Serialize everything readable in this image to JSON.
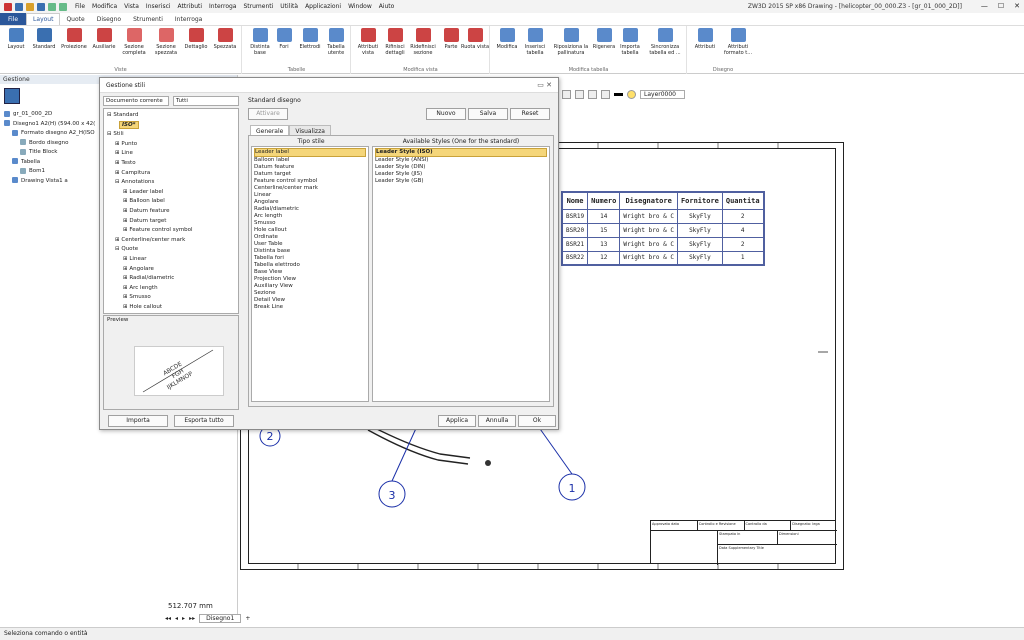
{
  "quick_menu": [
    "File",
    "Modifica",
    "Vista",
    "Inserisci",
    "Attributi",
    "Interroga",
    "Strumenti",
    "Utilità",
    "Applicazioni",
    "Window",
    "Aiuto"
  ],
  "window_title": "ZW3D 2015 SP x86    Drawing - [helicopter_00_000.Z3 - [gr_01_000_2D]]",
  "ribbon_tabs": [
    "File",
    "Layout",
    "Quote",
    "Disegno",
    "Strumenti",
    "Interroga"
  ],
  "active_tab": "Layout",
  "ribbon": {
    "viste": {
      "label": "Viste",
      "buttons": [
        "Layout",
        "Standard",
        "Proiezione",
        "Ausiliarie",
        "Sezione completa",
        "Sezione spezzata",
        "Dettaglio",
        "Spezzata"
      ]
    },
    "tabelle": {
      "label": "Tabelle",
      "buttons": [
        "Distinta base",
        "Fori",
        "Elettrodi",
        "Tabella utente"
      ]
    },
    "modifica_vista": {
      "label": "Modifica vista",
      "buttons": [
        "Attributi vista",
        "Rifinisci dettagli",
        "Ridefinisci sezione",
        "Parte",
        "Ruota vista"
      ]
    },
    "modifica_tabella": {
      "label": "Modifica tabella",
      "buttons": [
        "Modifica",
        "Inserisci tabella",
        "Riposiziona la pallinatura",
        "Rigenera",
        "Importa tabella",
        "Sincronizza tabella ed ..."
      ]
    },
    "disegno": {
      "label": "Disegno",
      "buttons": [
        "Attributi",
        "Attributi formato t..."
      ]
    }
  },
  "left_panel": {
    "title": "Gestione",
    "tree": [
      "gr_01_000_2D",
      "Disegno1 A2(H) (594.00 x 42(",
      "Formato disegno A2_H(ISO",
      "Bordo disegno",
      "Title Block",
      "Tabella",
      "Bom1",
      "Drawing Vista1 a"
    ]
  },
  "layer": "Layer0000",
  "bom": {
    "headers": [
      "Nome",
      "Numero",
      "Disegnatore",
      "Fornitore",
      "Quantita"
    ],
    "rows": [
      [
        "BSR19",
        "14",
        "Wright bro & C",
        "SkyFly",
        "2"
      ],
      [
        "BSR20",
        "15",
        "Wright bro & C",
        "SkyFly",
        "4"
      ],
      [
        "BSR21",
        "13",
        "Wright bro & C",
        "SkyFly",
        "2"
      ],
      [
        "BSR22",
        "12",
        "Wright bro & C",
        "SkyFly",
        "1"
      ]
    ]
  },
  "balloons": [
    "1",
    "2",
    "3"
  ],
  "title_block": {
    "cells": [
      "Approvato data",
      "Controllo e Revisione",
      "Controllo da",
      "Disegnato: lega",
      "Stampato in",
      "Dimensioni",
      "Data Supplementary Title"
    ]
  },
  "coords": "512.707 mm",
  "sheet_tab": "Disegno1",
  "status": "Seleziona comando o entità",
  "dialog": {
    "title": "Gestione stili",
    "scope": "Documento corrente",
    "filter": "Tutti",
    "standard_disegno": "Standard disegno",
    "activate": "Attivare",
    "nuovo": "Nuovo",
    "salva": "Salva",
    "reset": "Reset",
    "tabs": [
      "Generale",
      "Visualizza"
    ],
    "col_left": "Tipo stile",
    "col_right": "Available Styles (One for the standard)",
    "style_types": [
      "Leader label",
      "Balloon label",
      "Datum feature",
      "Datum target",
      "Feature control symbol",
      "Centerline/center mark",
      "Linear",
      "Angolare",
      "Radial/diametric",
      "Arc length",
      "Smusso",
      "Hole callout",
      "Ordinate",
      "User Table",
      "Distinta base",
      "Tabella fori",
      "Tabella elettrodo",
      "Base View",
      "Projection View",
      "Auxiliary View",
      "Sezione",
      "Detail View",
      "Break Line"
    ],
    "available": [
      "Leader Style (ISO)",
      "Leader Style (ANSI)",
      "Leader Style (DIN)",
      "Leader Style (JIS)",
      "Leader Style (GB)"
    ],
    "tree": [
      "Standard",
      "ISO*",
      "Stili",
      "Punto",
      "Line",
      "Testo",
      "Campitura",
      "Annotations",
      "Leader label",
      "Balloon label",
      "Datum feature",
      "Datum target",
      "Feature control symbol",
      "Centerline/center mark",
      "Quote",
      "Linear",
      "Angolare",
      "Radial/diametric",
      "Arc length",
      "Smusso",
      "Hole callout"
    ],
    "preview": "Preview",
    "preview_text": [
      "ABCDE",
      "FGH",
      "IJKLMNOP"
    ],
    "importa": "Importa",
    "esporta": "Esporta tutto",
    "applica": "Applica",
    "annulla": "Annulla",
    "ok": "Ok"
  }
}
